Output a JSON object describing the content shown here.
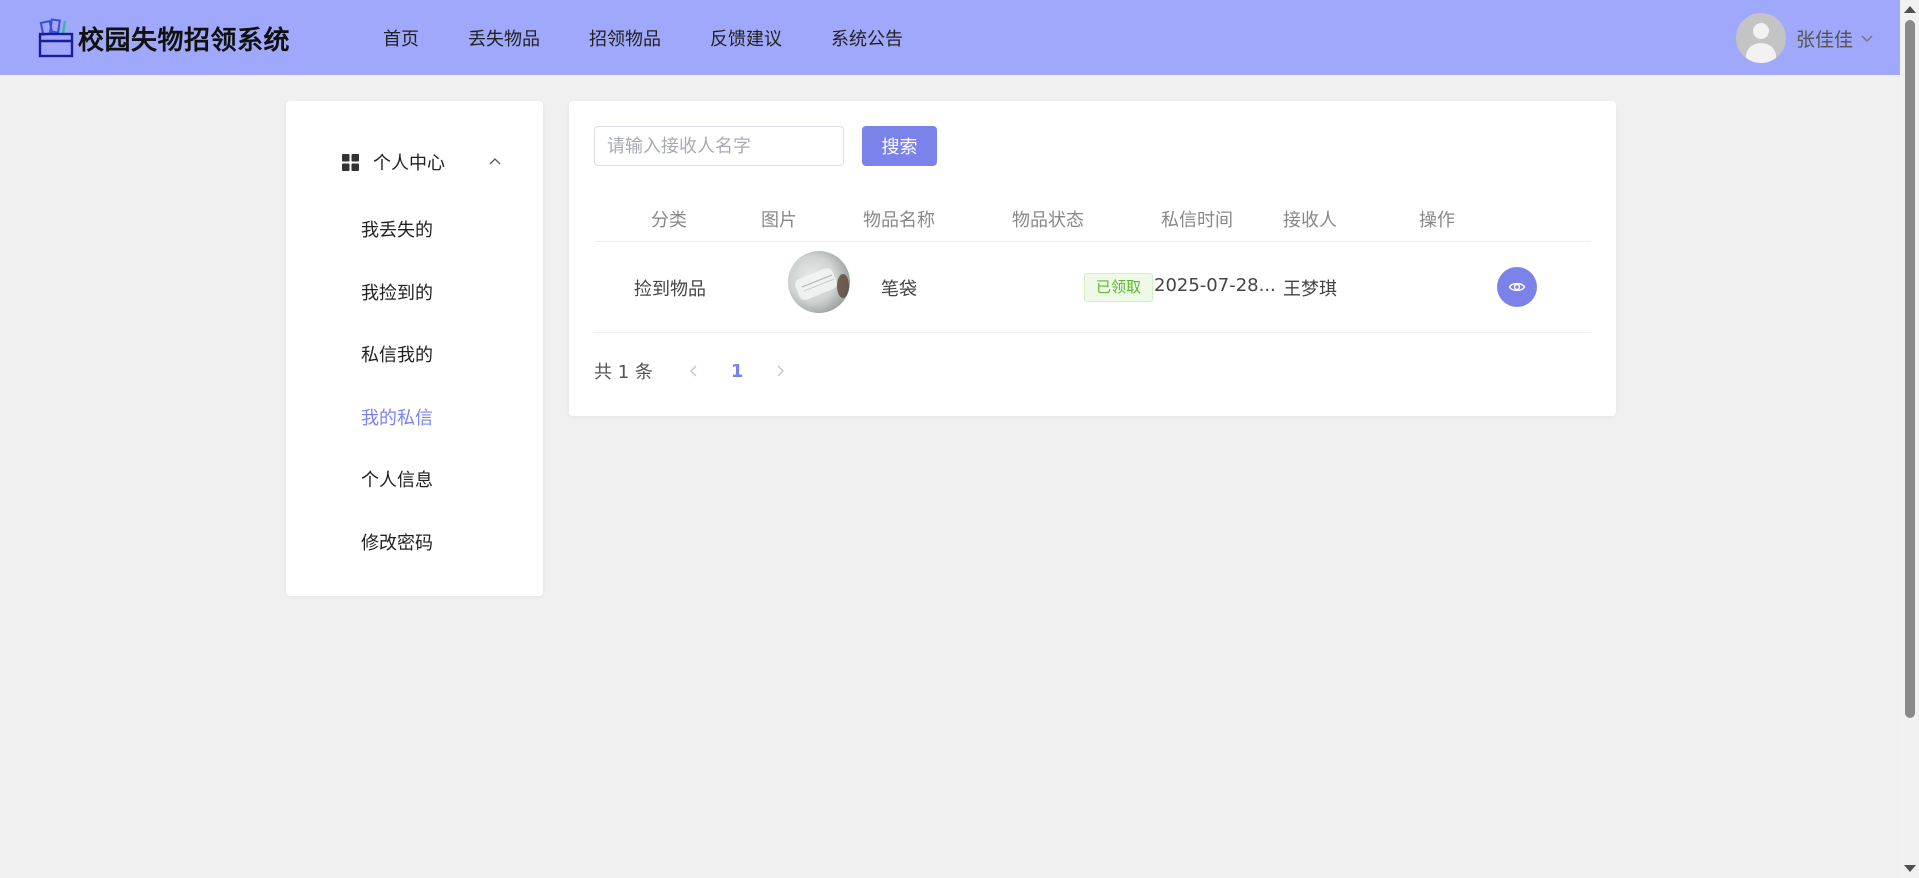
{
  "app": {
    "title": "校园失物招领系统"
  },
  "nav": [
    {
      "label": "首页"
    },
    {
      "label": "丢失物品"
    },
    {
      "label": "招领物品"
    },
    {
      "label": "反馈建议"
    },
    {
      "label": "系统公告"
    }
  ],
  "user": {
    "name": "张佳佳",
    "avatar_icon": "default-avatar-icon",
    "caret_icon": "chevron-down-icon"
  },
  "sidebar": {
    "header": {
      "label": "个人中心",
      "icon": "grid-icon",
      "expanded": true
    },
    "items": [
      {
        "label": "我丢失的",
        "active": false
      },
      {
        "label": "我捡到的",
        "active": false
      },
      {
        "label": "私信我的",
        "active": false
      },
      {
        "label": "我的私信",
        "active": true
      },
      {
        "label": "个人信息",
        "active": false
      },
      {
        "label": "修改密码",
        "active": false
      }
    ]
  },
  "search": {
    "placeholder": "请输入接收人名字",
    "value": "",
    "button_label": "搜索"
  },
  "table": {
    "columns": [
      "分类",
      "图片",
      "物品名称",
      "物品状态",
      "私信时间",
      "接收人",
      "操作"
    ],
    "rows": [
      {
        "category": "捡到物品",
        "image_icon": "item-thumbnail",
        "name": "笔袋",
        "status": "已领取",
        "time": "2025-07-28...",
        "receiver": "王梦琪",
        "action_icon": "eye-icon"
      }
    ]
  },
  "pagination": {
    "total_label": "共 1 条",
    "current_page": "1"
  },
  "colors": {
    "header_bg": "#9fa8fb",
    "accent": "#7b83eb",
    "page_bg": "#f0f0f0",
    "status_success_text": "#5aba2c",
    "status_success_bg": "#eef9e8"
  }
}
